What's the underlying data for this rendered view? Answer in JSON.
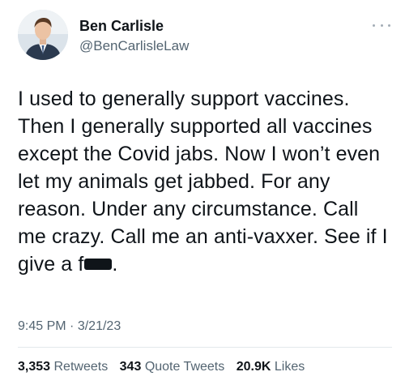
{
  "author": {
    "display_name": "Ben Carlisle",
    "handle": "@BenCarlisleLaw",
    "avatar_icon": "profile-photo"
  },
  "tweet": {
    "text_before": "I used to generally support vaccines. Then I generally supported all vaccines except the Covid jabs. Now I won’t even let my animals get jabbed. For any reason. Under any circumstance. Call me crazy. Call me an anti-vaxxer. See if I give a f",
    "text_after": ".",
    "time": "9:45 PM",
    "separator": "·",
    "date": "3/21/23"
  },
  "stats": {
    "retweets_count": "3,353",
    "retweets_label": "Retweets",
    "quotes_count": "343",
    "quotes_label": "Quote Tweets",
    "likes_count": "20.9K",
    "likes_label": "Likes"
  },
  "colors": {
    "text": "#0f1419",
    "secondary": "#536471",
    "divider": "#e3e8ec"
  }
}
